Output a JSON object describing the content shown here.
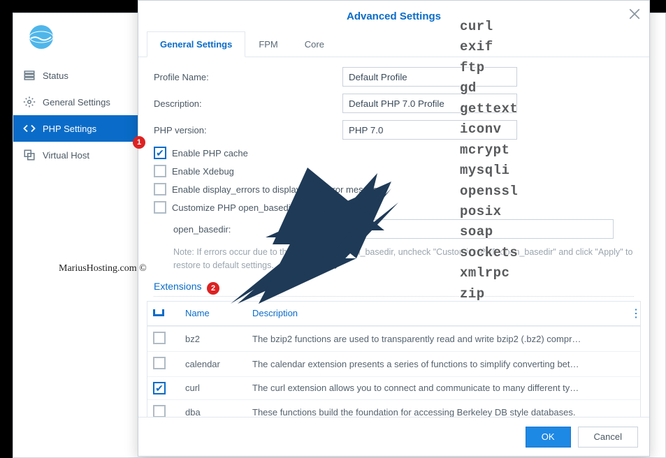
{
  "dialog": {
    "title": "Advanced Settings"
  },
  "sidebar": {
    "items": [
      {
        "label": "Status"
      },
      {
        "label": "General Settings"
      },
      {
        "label": "PHP Settings"
      },
      {
        "label": "Virtual Host"
      }
    ]
  },
  "tabs": [
    {
      "label": "General Settings"
    },
    {
      "label": "FPM"
    },
    {
      "label": "Core"
    }
  ],
  "form": {
    "profile_name_label": "Profile Name:",
    "profile_name_value": "Default Profile",
    "desc_label": "Description:",
    "desc_value": "Default PHP 7.0 Profile",
    "version_label": "PHP version:",
    "version_value": "PHP 7.0",
    "cache_label": "Enable PHP cache",
    "xdebug_label": "Enable Xdebug",
    "errors_label": "Enable display_errors to display PHP error message",
    "basedir_label": "Customize PHP open_basedir",
    "basedir_field_label": "open_basedir:",
    "basedir_value": "",
    "note_prefix": "Note: ",
    "note_text": "If errors occur due to the customized open_basedir, uncheck \"Customize PHP open_basedir\" and click \"Apply\" to restore to default settings."
  },
  "extensions": {
    "title": "Extensions",
    "cols": {
      "name": "Name",
      "desc": "Description"
    },
    "rows": [
      {
        "checked": false,
        "name": "bz2",
        "desc": "The bzip2 functions are used to transparently read and write bzip2 (.bz2) compr…"
      },
      {
        "checked": false,
        "name": "calendar",
        "desc": "The calendar extension presents a series of functions to simplify converting bet…"
      },
      {
        "checked": true,
        "name": "curl",
        "desc": "The curl extension allows you to connect and communicate to many different ty…"
      },
      {
        "checked": false,
        "name": "dba",
        "desc": "These functions build the foundation for accessing Berkeley DB style databases."
      }
    ]
  },
  "overlay_items": [
    "curl",
    "exif",
    "ftp",
    "gd",
    "gettext",
    "iconv",
    "mcrypt",
    "mysqli",
    "openssl",
    "posix",
    "soap",
    "sockets",
    "xmlrpc",
    "zip"
  ],
  "buttons": {
    "ok": "OK",
    "cancel": "Cancel"
  },
  "watermark": "MariusHosting.com ©",
  "badges": {
    "one": "1",
    "two": "2"
  }
}
